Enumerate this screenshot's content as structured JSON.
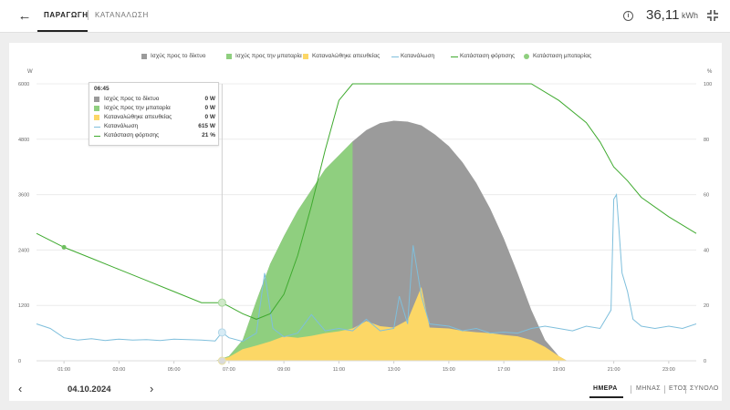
{
  "header": {
    "back_icon": "arrow-left-icon",
    "tabs": [
      {
        "label": "ΠΑΡΑΓΩΓΗ",
        "active": true
      },
      {
        "label": "ΚΑΤΑΝΑΛΩΣΗ",
        "active": false
      }
    ],
    "info_icon": "info-circle-icon",
    "info_glyph": "i",
    "total_value": "36,11",
    "total_unit": "kWh",
    "collapse_icon": "fullscreen-exit-icon"
  },
  "chart_data": {
    "type": "area",
    "title": "",
    "x_label": "",
    "y_left_unit": "W",
    "y_right_unit": "%",
    "y_left_range": [
      0,
      6000
    ],
    "y_right_range": [
      0,
      100
    ],
    "y_left_ticks": [
      "0",
      "1200",
      "2400",
      "3600",
      "4800",
      "6000"
    ],
    "y_right_ticks": [
      "0",
      "20",
      "40",
      "60",
      "80",
      "100"
    ],
    "x_ticks": [
      "01:00",
      "03:00",
      "05:00",
      "07:00",
      "09:00",
      "11:00",
      "13:00",
      "15:00",
      "17:00",
      "19:00",
      "21:00",
      "23:00"
    ],
    "x_range_hours": [
      0,
      24
    ],
    "legend": [
      {
        "name": "Ισχύς προς το δίκτυο",
        "color": "#9b9b9b",
        "kind": "area"
      },
      {
        "name": "Ισχύς προς την μπαταρία",
        "color": "#8fcf7f",
        "kind": "area"
      },
      {
        "name": "Καταναλώθηκε απευθείας",
        "color": "#fcd766",
        "kind": "area"
      },
      {
        "name": "Κατανάλωση",
        "color": "#7fbfdc",
        "kind": "line"
      },
      {
        "name": "Κατάσταση φόρτισης",
        "color": "#3faa2f",
        "kind": "line"
      },
      {
        "name": "Κατάσταση μπαταρίας",
        "color": "#8fcf7f",
        "kind": "dot"
      }
    ],
    "production_w": [
      [
        6.5,
        0
      ],
      [
        7,
        100
      ],
      [
        7.5,
        450
      ],
      [
        8,
        1300
      ],
      [
        8.5,
        2100
      ],
      [
        9,
        2700
      ],
      [
        9.5,
        3250
      ],
      [
        10,
        3700
      ],
      [
        10.5,
        4150
      ],
      [
        11,
        4450
      ],
      [
        11.5,
        4750
      ],
      [
        12,
        5000
      ],
      [
        12.5,
        5150
      ],
      [
        13,
        5200
      ],
      [
        13.5,
        5180
      ],
      [
        14,
        5100
      ],
      [
        14.5,
        4900
      ],
      [
        15,
        4650
      ],
      [
        15.5,
        4300
      ],
      [
        16,
        3850
      ],
      [
        16.5,
        3300
      ],
      [
        17,
        2650
      ],
      [
        17.5,
        1900
      ],
      [
        18,
        1100
      ],
      [
        18.5,
        450
      ],
      [
        19,
        100
      ],
      [
        19.3,
        0
      ]
    ],
    "battery_charge_end_hour": 11.5,
    "direct_consumption_w": [
      [
        6.5,
        0
      ],
      [
        7,
        80
      ],
      [
        7.5,
        250
      ],
      [
        8,
        330
      ],
      [
        8.5,
        420
      ],
      [
        9,
        530
      ],
      [
        9.5,
        500
      ],
      [
        10,
        540
      ],
      [
        10.5,
        600
      ],
      [
        11,
        640
      ],
      [
        11.5,
        700
      ],
      [
        12,
        860
      ],
      [
        12.5,
        750
      ],
      [
        13,
        720
      ],
      [
        13.5,
        880
      ],
      [
        14,
        1600
      ],
      [
        14.3,
        720
      ],
      [
        15,
        700
      ],
      [
        15.5,
        650
      ],
      [
        16,
        620
      ],
      [
        16.5,
        600
      ],
      [
        17,
        560
      ],
      [
        17.5,
        530
      ],
      [
        18,
        450
      ],
      [
        18.5,
        300
      ],
      [
        19,
        100
      ],
      [
        19.3,
        0
      ]
    ],
    "consumption_w": [
      [
        0,
        800
      ],
      [
        0.5,
        700
      ],
      [
        1,
        500
      ],
      [
        1.5,
        450
      ],
      [
        2,
        480
      ],
      [
        2.5,
        440
      ],
      [
        3,
        470
      ],
      [
        3.5,
        450
      ],
      [
        4,
        460
      ],
      [
        4.5,
        440
      ],
      [
        5,
        470
      ],
      [
        5.5,
        460
      ],
      [
        6,
        450
      ],
      [
        6.5,
        430
      ],
      [
        6.75,
        615
      ],
      [
        7,
        500
      ],
      [
        7.5,
        420
      ],
      [
        8,
        600
      ],
      [
        8.3,
        1900
      ],
      [
        8.6,
        700
      ],
      [
        9,
        520
      ],
      [
        9.5,
        600
      ],
      [
        10,
        1000
      ],
      [
        10.5,
        650
      ],
      [
        11,
        700
      ],
      [
        11.5,
        650
      ],
      [
        12,
        900
      ],
      [
        12.5,
        650
      ],
      [
        13,
        700
      ],
      [
        13.2,
        1400
      ],
      [
        13.5,
        800
      ],
      [
        13.7,
        2500
      ],
      [
        14,
        1400
      ],
      [
        14.3,
        800
      ],
      [
        15,
        750
      ],
      [
        15.5,
        650
      ],
      [
        16,
        700
      ],
      [
        16.5,
        600
      ],
      [
        17,
        620
      ],
      [
        17.5,
        600
      ],
      [
        18,
        700
      ],
      [
        18.5,
        750
      ],
      [
        19,
        700
      ],
      [
        19.5,
        650
      ],
      [
        20,
        750
      ],
      [
        20.5,
        700
      ],
      [
        20.9,
        1100
      ],
      [
        21,
        3500
      ],
      [
        21.1,
        3600
      ],
      [
        21.3,
        1900
      ],
      [
        21.5,
        1500
      ],
      [
        21.7,
        900
      ],
      [
        22,
        750
      ],
      [
        22.5,
        700
      ],
      [
        23,
        750
      ],
      [
        23.5,
        700
      ],
      [
        24,
        800
      ]
    ],
    "state_of_charge_pct": [
      [
        0,
        46
      ],
      [
        1,
        41
      ],
      [
        2,
        37
      ],
      [
        3,
        33
      ],
      [
        4,
        29
      ],
      [
        5,
        25
      ],
      [
        6,
        21
      ],
      [
        6.75,
        21
      ],
      [
        7.5,
        17
      ],
      [
        8,
        15
      ],
      [
        8.5,
        17
      ],
      [
        9,
        24
      ],
      [
        9.5,
        38
      ],
      [
        10,
        56
      ],
      [
        10.5,
        76
      ],
      [
        11,
        94
      ],
      [
        11.5,
        100
      ],
      [
        18,
        100
      ],
      [
        19,
        94
      ],
      [
        20,
        86
      ],
      [
        20.5,
        79
      ],
      [
        21,
        70
      ],
      [
        21.5,
        65
      ],
      [
        22,
        59
      ],
      [
        23,
        52
      ],
      [
        24,
        46
      ]
    ],
    "tooltip": {
      "time": "06:45",
      "rows": [
        {
          "label": "Ισχύς προς το δίκτυο",
          "value": "0 W"
        },
        {
          "label": "Ισχύς προς την μπαταρία",
          "value": "0 W"
        },
        {
          "label": "Καταναλώθηκε απευθείας",
          "value": "0 W"
        },
        {
          "label": "Κατανάλωση",
          "value": "615 W"
        },
        {
          "label": "Κατάσταση φόρτισης",
          "value": "21 %"
        }
      ]
    },
    "cursor_hour": 6.75
  },
  "footer": {
    "prev_icon": "chevron-left-icon",
    "next_icon": "chevron-right-icon",
    "prev_glyph": "‹",
    "next_glyph": "›",
    "date": "04.10.2024",
    "periods": [
      {
        "label": "ΗΜΕΡΑ",
        "active": true
      },
      {
        "label": "ΜΗΝΑΣ",
        "active": false
      },
      {
        "label": "ΕΤΟΣ",
        "active": false
      },
      {
        "label": "ΣΥΝΟΛΟ",
        "active": false
      }
    ]
  }
}
